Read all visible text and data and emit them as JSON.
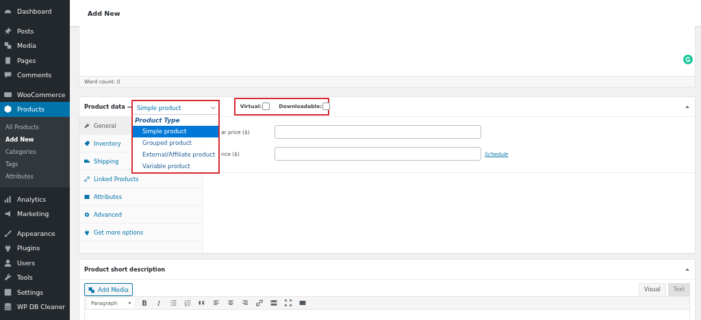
{
  "sidebar": {
    "items": [
      {
        "label": "Dashboard",
        "selected": false
      },
      {
        "label": "Posts",
        "selected": false
      },
      {
        "label": "Media",
        "selected": false
      },
      {
        "label": "Pages",
        "selected": false
      },
      {
        "label": "Comments",
        "selected": false
      },
      {
        "label": "WooCommerce",
        "selected": false
      },
      {
        "label": "Products",
        "selected": true,
        "children": [
          {
            "label": "All Products",
            "selected": false
          },
          {
            "label": "Add New",
            "selected": true
          },
          {
            "label": "Categories",
            "selected": false
          },
          {
            "label": "Tags",
            "selected": false
          },
          {
            "label": "Attributes",
            "selected": false
          }
        ]
      },
      {
        "label": "Analytics",
        "selected": false
      },
      {
        "label": "Marketing",
        "selected": false
      },
      {
        "label": "Appearance",
        "selected": false
      },
      {
        "label": "Plugins",
        "selected": false
      },
      {
        "label": "Users",
        "selected": false
      },
      {
        "label": "Tools",
        "selected": false
      },
      {
        "label": "Settings",
        "selected": false
      },
      {
        "label": "WP DB Cleaner",
        "selected": false
      }
    ]
  },
  "header": {
    "title": "Add New"
  },
  "editor": {
    "word_count": "Word count: 0"
  },
  "product_data": {
    "title": "Product data —",
    "type_select": {
      "value": "Simple product",
      "expanded": true,
      "group": "Product Type",
      "options": [
        {
          "label": "Simple product",
          "selected": true
        },
        {
          "label": "Grouped product",
          "selected": false
        },
        {
          "label": "External/Affiliate product",
          "selected": false
        },
        {
          "label": "Variable product",
          "selected": false
        }
      ]
    },
    "checks": [
      {
        "label": "Virtual:",
        "checked": false
      },
      {
        "label": "Downloadable:",
        "checked": false
      }
    ],
    "tabs": [
      {
        "label": "General",
        "selected": true
      },
      {
        "label": "Inventory",
        "selected": false
      },
      {
        "label": "Shipping",
        "selected": false
      },
      {
        "label": "Linked Products",
        "selected": false
      },
      {
        "label": "Attributes",
        "selected": false
      },
      {
        "label": "Advanced",
        "selected": false
      },
      {
        "label": "Get more options",
        "selected": false
      }
    ],
    "fields": [
      {
        "label": "ar price ($)"
      },
      {
        "label": "rice ($)",
        "link": "Schedule"
      }
    ]
  },
  "short_description": {
    "title": "Product short description",
    "add_media": "Add Media",
    "editor_tabs": [
      {
        "label": "Visual",
        "selected": true
      },
      {
        "label": "Text",
        "selected": false
      }
    ],
    "format": "Paragraph",
    "text_buttons": [
      "B",
      "I"
    ]
  }
}
